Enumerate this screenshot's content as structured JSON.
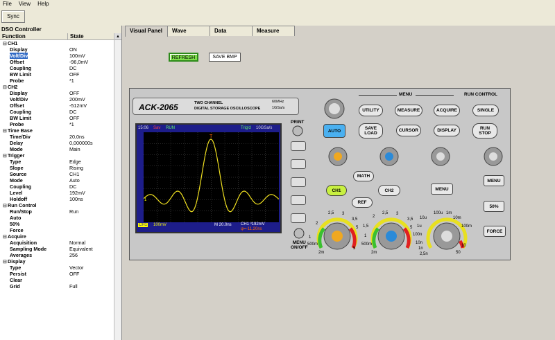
{
  "menubar": {
    "file": "File",
    "view": "View",
    "help": "Help"
  },
  "toolbar": {
    "sync": "Sync"
  },
  "tree": {
    "title": "DSO Controller",
    "col_function": "Function",
    "col_state": "State",
    "rows": [
      {
        "f": "CH1",
        "v": "",
        "lvl": 0,
        "grp": true
      },
      {
        "f": "Display",
        "v": "ON",
        "lvl": 1
      },
      {
        "f": "Volt/Div",
        "v": "100mV",
        "lvl": 1,
        "sel": true
      },
      {
        "f": "Offset",
        "v": "-96,0mV",
        "lvl": 1
      },
      {
        "f": "Coupling",
        "v": "DC",
        "lvl": 1
      },
      {
        "f": "BW Limit",
        "v": "OFF",
        "lvl": 1
      },
      {
        "f": "Probe",
        "v": "*1",
        "lvl": 1
      },
      {
        "f": "CH2",
        "v": "",
        "lvl": 0,
        "grp": true
      },
      {
        "f": "Display",
        "v": "OFF",
        "lvl": 1
      },
      {
        "f": "Volt/Div",
        "v": "200mV",
        "lvl": 1
      },
      {
        "f": "Offset",
        "v": "-512mV",
        "lvl": 1
      },
      {
        "f": "Coupling",
        "v": "DC",
        "lvl": 1
      },
      {
        "f": "BW Limit",
        "v": "OFF",
        "lvl": 1
      },
      {
        "f": "Probe",
        "v": "*1",
        "lvl": 1
      },
      {
        "f": "Time Base",
        "v": "",
        "lvl": 0,
        "grp": true
      },
      {
        "f": "Time/Div",
        "v": "20,0ns",
        "lvl": 1
      },
      {
        "f": "Delay",
        "v": "0,000000s",
        "lvl": 1
      },
      {
        "f": "Mode",
        "v": "Main",
        "lvl": 1
      },
      {
        "f": "Trigger",
        "v": "",
        "lvl": 0,
        "grp": true
      },
      {
        "f": "Type",
        "v": "Edge",
        "lvl": 1
      },
      {
        "f": "Slope",
        "v": "Rising",
        "lvl": 1
      },
      {
        "f": "Source",
        "v": "CH1",
        "lvl": 1
      },
      {
        "f": "Mode",
        "v": "Auto",
        "lvl": 1
      },
      {
        "f": "Coupling",
        "v": "DC",
        "lvl": 1
      },
      {
        "f": "Level",
        "v": "192mV",
        "lvl": 1
      },
      {
        "f": "Holdoff",
        "v": "100ns",
        "lvl": 1
      },
      {
        "f": "Run Control",
        "v": "",
        "lvl": 0,
        "grp": true
      },
      {
        "f": "Run/Stop",
        "v": "Run",
        "lvl": 1
      },
      {
        "f": "Auto",
        "v": "",
        "lvl": 1
      },
      {
        "f": "50%",
        "v": "",
        "lvl": 1
      },
      {
        "f": "Force",
        "v": "",
        "lvl": 1
      },
      {
        "f": "Acquire",
        "v": "",
        "lvl": 0,
        "grp": true
      },
      {
        "f": "Acquisition",
        "v": "Normal",
        "lvl": 1
      },
      {
        "f": "Sampling Mode",
        "v": "Equivalent",
        "lvl": 1
      },
      {
        "f": "Averages",
        "v": "256",
        "lvl": 1
      },
      {
        "f": "Display",
        "v": "",
        "lvl": 0,
        "grp": true
      },
      {
        "f": "Type",
        "v": "Vector",
        "lvl": 1
      },
      {
        "f": "Persist",
        "v": "OFF",
        "lvl": 1
      },
      {
        "f": "Clear",
        "v": "",
        "lvl": 1
      },
      {
        "f": "Grid",
        "v": "Full",
        "lvl": 1
      }
    ]
  },
  "tabs": [
    "Visual Panel",
    "Wave",
    "Data",
    "Measure"
  ],
  "visual": {
    "refresh": "REFRESH",
    "save_bmp": "SAVE BMP"
  },
  "scope": {
    "model": "ACK-2065",
    "desc1": "TWO CHANNEL",
    "desc2": "DIGITAL STORAGE OSCILLOSCOPE",
    "spec1": "60MHz",
    "spec2": "1GSa/s",
    "lcd_time": "15:06",
    "lcd_mode1": "Sav",
    "lcd_mode2": "RUN",
    "lcd_trig": "Trig'd",
    "lcd_rate": "10GSa/s",
    "lcd_ch1": "CH1",
    "lcd_volt": "100mV",
    "lcd_m": "M 20.0ns",
    "lcd_trig_lvl": "CH1 ³192mV",
    "lcd_delta": "ψ=-11.20ns",
    "lcd_marker": "T",
    "lcd_ground": "1",
    "menu_title": "MENU",
    "run_title": "RUN CONTROL",
    "buttons": {
      "utility": "UTILITY",
      "measure": "MEASURE",
      "acquire": "ACQUIRE",
      "single": "SINGLE",
      "auto": "AUTO",
      "save_load": "SAVE\nLOAD",
      "cursor": "CURSOR",
      "display": "DISPLAY",
      "run_stop": "RUN\nSTOP",
      "math": "MATH",
      "ch1": "CH1",
      "ch2": "CH2",
      "ref": "REF",
      "menu_trig": "MENU",
      "menu_right": "MENU",
      "fifty": "50%",
      "force": "FORCE"
    },
    "print": "PRINT",
    "menu_onoff": "MENU\nON/OFF",
    "dial1_labels": [
      "2",
      "2,5",
      "3",
      "3,5",
      "5",
      "1",
      "500m",
      "2m",
      "5"
    ],
    "dial2_labels": [
      "2",
      "2,5",
      "3",
      "3,5",
      "5",
      "1,5",
      "1",
      "500m",
      "2m"
    ],
    "dial3_labels": [
      "100u",
      "1m",
      "10m",
      "100m",
      "10u",
      "1u",
      "100n",
      "10n",
      "1n",
      "2,5n",
      "10",
      "50"
    ]
  },
  "colors": {
    "ch1_wave": "#f0e020",
    "lcd_bg": "#1d1d8a",
    "auto_btn": "#4ab0f0",
    "ch1_btn": "#c8f040",
    "refresh": "#7ee04a"
  }
}
